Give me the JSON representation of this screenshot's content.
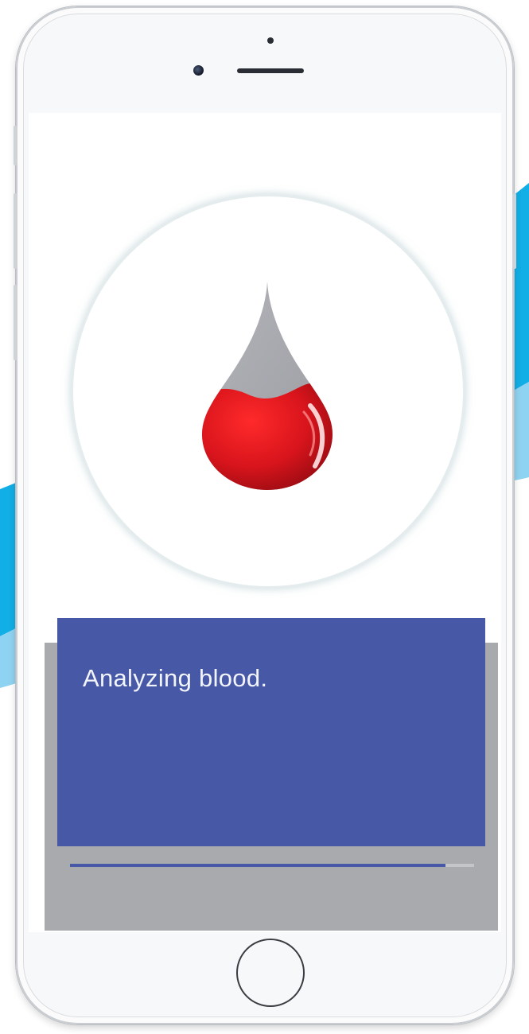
{
  "dialog": {
    "message": "Analyzing blood."
  },
  "progress": {
    "fraction": 0.93
  },
  "icons": {
    "main": "blood-drop-icon",
    "home": "home-button"
  },
  "colors": {
    "dialog_background": "#4759a6",
    "dialog_text": "#f2f4fa",
    "overlay_gray": "#a9aaad",
    "progress_fill": "#4759a6",
    "progress_track": "#c4c5c9",
    "blood_red": "#d8141c",
    "drop_gray": "#a7a8ad",
    "background_wave_blue": "#12aee6",
    "background_wave_light": "#8fd3f2"
  }
}
